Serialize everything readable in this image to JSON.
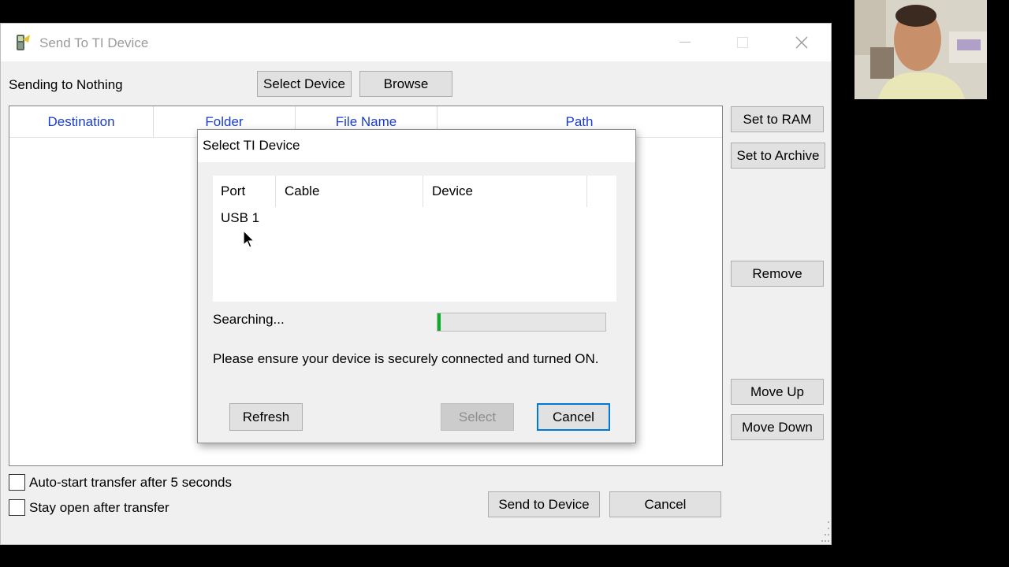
{
  "window": {
    "title": "Send To TI Device",
    "sending_label": "Sending to Nothing",
    "select_device_label": "Select Device",
    "browse_label": "Browse"
  },
  "file_list": {
    "columns": [
      "Destination",
      "Folder",
      "File Name",
      "Path"
    ]
  },
  "side_buttons": {
    "set_ram": "Set to RAM",
    "set_archive": "Set to Archive",
    "remove": "Remove",
    "move_up": "Move Up",
    "move_down": "Move Down"
  },
  "options": {
    "auto_start": "Auto-start transfer after 5 seconds",
    "auto_start_checked": false,
    "stay_open": "Stay open after transfer",
    "stay_open_checked": false
  },
  "footer": {
    "send_label": "Send to Device",
    "cancel_label": "Cancel"
  },
  "dialog": {
    "title": "Select TI Device",
    "columns": [
      "Port",
      "Cable",
      "Device"
    ],
    "rows": [
      {
        "port": "USB 1",
        "cable": "",
        "device": ""
      }
    ],
    "status": "Searching...",
    "progress_fraction": 0.02,
    "message": "Please ensure your device is securely connected and turned ON.",
    "refresh_label": "Refresh",
    "select_label": "Select",
    "cancel_label": "Cancel"
  },
  "colors": {
    "header_link": "#1a3ccf",
    "progress": "#06b025",
    "focus_border": "#0078d7"
  }
}
